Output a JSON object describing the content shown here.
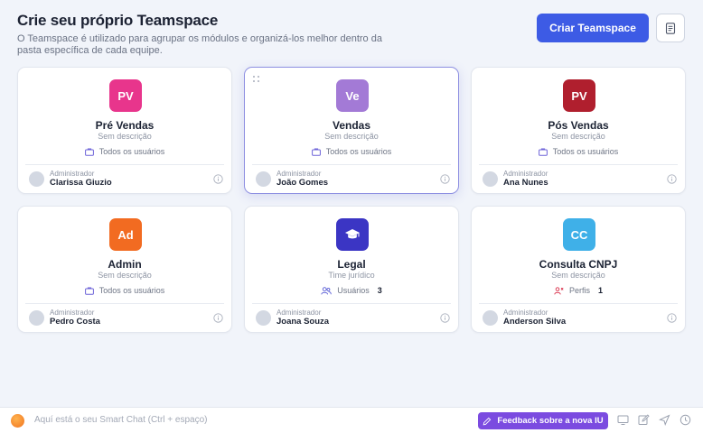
{
  "header": {
    "title": "Crie seu próprio Teamspace",
    "subtitle": "O Teamspace é utilizado para agrupar os módulos e organizá-los melhor dentro da pasta específica de cada equipe.",
    "create_button": "Criar Teamspace",
    "doc_icon": "document-icon"
  },
  "cards": [
    {
      "initials": "PV",
      "color": "#e8358c",
      "name": "Pré Vendas",
      "description": "Sem descrição",
      "access_icon": "briefcase-icon",
      "access": "Todos os usuários",
      "count": "",
      "admin_label": "Administrador",
      "admin_name": "Clarissa Giuzio"
    },
    {
      "initials": "Ve",
      "color": "#a37ad6",
      "name": "Vendas",
      "description": "Sem descrição",
      "access_icon": "briefcase-icon",
      "access": "Todos os usuários",
      "count": "",
      "admin_label": "Administrador",
      "admin_name": "João Gomes"
    },
    {
      "initials": "PV",
      "color": "#b01f2e",
      "name": "Pós Vendas",
      "description": "Sem descrição",
      "access_icon": "briefcase-icon",
      "access": "Todos os usuários",
      "count": "",
      "admin_label": "Administrador",
      "admin_name": "Ana Nunes"
    },
    {
      "initials": "Ad",
      "color": "#f26b21",
      "name": "Admin",
      "description": "Sem descrição",
      "access_icon": "briefcase-icon",
      "access": "Todos os usuários",
      "count": "",
      "admin_label": "Administrador",
      "admin_name": "Pedro Costa"
    },
    {
      "initials": "",
      "color": "#3b35c4",
      "name": "Legal",
      "description": "Time jurídico",
      "access_icon": "users-icon",
      "access": "Usuários",
      "count": "3",
      "admin_label": "Administrador",
      "admin_name": "Joana Souza"
    },
    {
      "initials": "CC",
      "color": "#3fb0e8",
      "name": "Consulta CNPJ",
      "description": "Sem descrição",
      "access_icon": "profile-icon",
      "access": "Perfis",
      "count": "1",
      "admin_label": "Administrador",
      "admin_name": "Anderson Silva"
    }
  ],
  "bottombar": {
    "chat_placeholder": "Aquí está o seu Smart Chat (Ctrl + espaço)",
    "feedback_button": "Feedback sobre a nova IU"
  }
}
